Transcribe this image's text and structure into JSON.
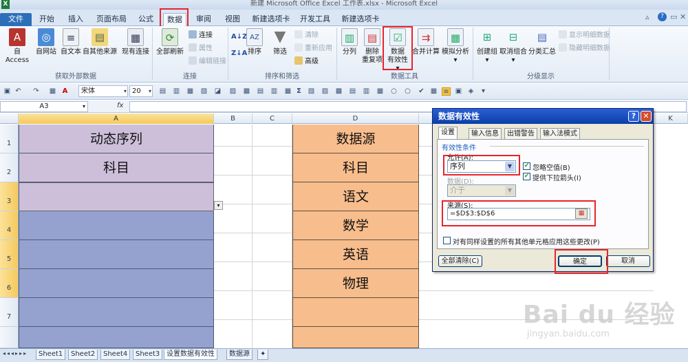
{
  "window": {
    "title": "新建 Microsoft Office Excel 工作表.xlsx  -  Microsoft Excel",
    "logo": "X"
  },
  "ribbon_tabs": [
    {
      "label": "文件"
    },
    {
      "label": "开始"
    },
    {
      "label": "插入"
    },
    {
      "label": "页面布局"
    },
    {
      "label": "公式"
    },
    {
      "label": "数据"
    },
    {
      "label": "审阅"
    },
    {
      "label": "视图"
    },
    {
      "label": "新建选项卡"
    },
    {
      "label": "开发工具"
    },
    {
      "label": "新建选项卡"
    }
  ],
  "groups": {
    "external": {
      "label": "获取外部数据",
      "buttons": [
        "自 Access",
        "自网站",
        "自文本",
        "自其他来源",
        "现有连接"
      ]
    },
    "connections": {
      "label": "连接",
      "refresh": "全部刷新",
      "connect": "连接",
      "properties": "属性",
      "edit_links": "编辑链接"
    },
    "sort_filter": {
      "label": "排序和筛选",
      "sort": "排序",
      "filter": "筛选",
      "clear": "清除",
      "reapply": "重新应用",
      "advanced": "高级"
    },
    "data_tools": {
      "label": "数据工具",
      "split": "分列",
      "remove_dup_1": "删除",
      "remove_dup_2": "重复项",
      "validation_1": "数据",
      "validation_2": "有效性",
      "consolidate": "合并计算",
      "whatif": "模拟分析"
    },
    "outline": {
      "label": "分级显示",
      "group": "创建组",
      "ungroup": "取消组合",
      "subtotal": "分类汇总",
      "show_detail": "显示明细数据",
      "hide_detail": "隐藏明细数据"
    }
  },
  "format_bar": {
    "font": "宋体",
    "size": "20"
  },
  "formula_bar": {
    "name_box": "A3",
    "fx": "fx"
  },
  "columns": [
    "A",
    "B",
    "C",
    "D",
    "K"
  ],
  "rows": [
    "1",
    "2",
    "3",
    "4",
    "5",
    "6",
    "7"
  ],
  "cells": {
    "A": [
      "动态序列",
      "科目",
      "",
      "",
      "",
      "",
      ""
    ],
    "D": [
      "数据源",
      "科目",
      "语文",
      "数学",
      "英语",
      "物理",
      ""
    ]
  },
  "sheet_tabs": [
    "Sheet1",
    "Sheet2",
    "Sheet4",
    "Sheet3",
    "设置数据有效性",
    "数据源"
  ],
  "dialog": {
    "title": "数据有效性",
    "tabs": [
      "设置",
      "输入信息",
      "出错警告",
      "输入法模式"
    ],
    "section_label": "有效性条件",
    "allow_label": "允许(A):",
    "allow_value": "序列",
    "data_label": "数据(D):",
    "data_value": "介于",
    "ignore_blank": "忽略空值(B)",
    "dropdown": "提供下拉箭头(I)",
    "source_label": "来源(S):",
    "source_value": "=$D$3:$D$6",
    "apply_all": "对有同样设置的所有其他单元格应用这些更改(P)",
    "clear_all": "全部清除(C)",
    "ok": "确定",
    "cancel": "取消"
  },
  "colors": {
    "colA_header": "#cdbfda",
    "colA_body": "#95a2cf",
    "colD": "#f8bd8c",
    "highlight": "#e8232a",
    "title_blue": "#0b3fa7"
  },
  "watermark": {
    "line1": "Bai du 经验",
    "line2": "jingyan.baidu.com"
  }
}
